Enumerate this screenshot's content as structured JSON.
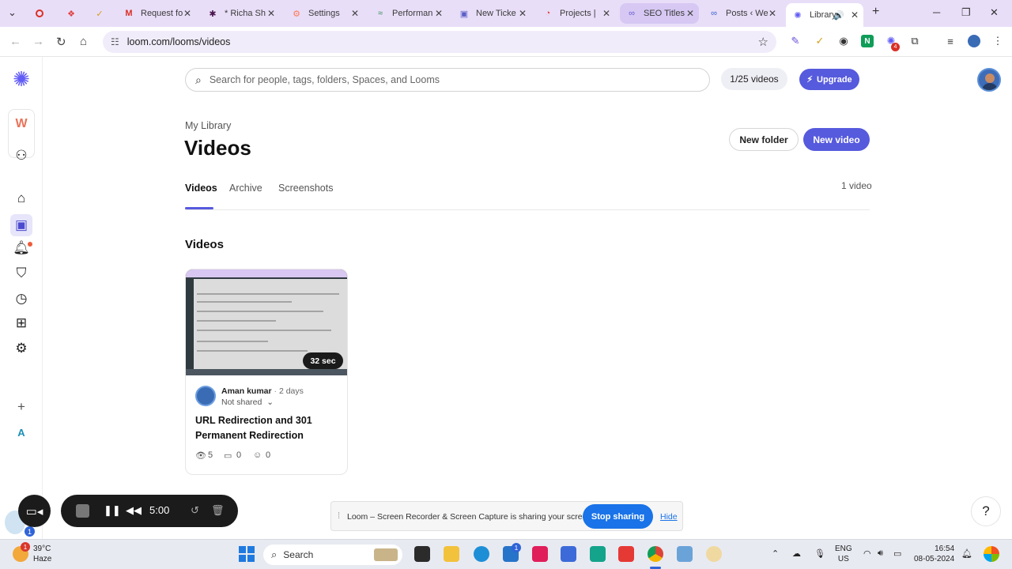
{
  "browser": {
    "tabs": [
      {
        "label": "",
        "icon": "record-icon",
        "color": "#d93025"
      },
      {
        "label": "",
        "icon": "extension-icon",
        "color": "#e04040"
      },
      {
        "label": "",
        "icon": "check-icon",
        "color": "#e0a020"
      },
      {
        "label": "Request fo",
        "icon": "gmail-icon",
        "color": "#d93025"
      },
      {
        "label": "* Richa Sh",
        "icon": "slack-icon",
        "color": "#4a154b"
      },
      {
        "label": "Settings",
        "icon": "hubspot-icon",
        "color": "#ff7a59"
      },
      {
        "label": "Performan",
        "icon": "semrush-icon",
        "color": "#2e8b57"
      },
      {
        "label": "New Ticke",
        "icon": "teams-icon",
        "color": "#5b5fc7"
      },
      {
        "label": "Projects |",
        "icon": "projects-icon",
        "color": "#e04040"
      },
      {
        "label": "SEO Titles",
        "icon": "link-icon",
        "color": "#6a5acd"
      },
      {
        "label": "Posts ‹ We",
        "icon": "link-icon",
        "color": "#3a5fcd"
      },
      {
        "label": "Library",
        "icon": "loom-icon",
        "color": "#625df5"
      }
    ],
    "url": "loom.com/looms/videos"
  },
  "header": {
    "search_placeholder": "Search for people, tags, folders, Spaces, and Looms",
    "quota": "1/25 videos",
    "upgrade_label": "Upgrade"
  },
  "sidebar": {
    "workspace_initial": "W",
    "bottom_initial": "A"
  },
  "page": {
    "breadcrumb": "My Library",
    "title": "Videos",
    "new_folder_label": "New folder",
    "new_video_label": "New video",
    "tabs": [
      "Videos",
      "Archive",
      "Screenshots"
    ],
    "video_count": "1 video",
    "section_title": "Videos"
  },
  "video": {
    "duration": "32 sec",
    "author": "Aman kumar",
    "age": "2 days",
    "sharing": "Not shared",
    "title": "URL Redirection and 301 Permanent Redirection",
    "views": "5",
    "comments": "0",
    "reactions": "0"
  },
  "recorder": {
    "timer": "5:00",
    "badge": "1"
  },
  "share_banner": {
    "message": "Loom – Screen Recorder & Screen Capture is sharing your screen.",
    "stop_label": "Stop sharing",
    "hide_label": "Hide"
  },
  "taskbar": {
    "weather_badge": "1",
    "temperature": "39°C",
    "condition": "Haze",
    "search_label": "Search",
    "store_badge": "1",
    "language": "ENG",
    "region": "US",
    "time": "16:54",
    "date": "08-05-2024"
  },
  "extensions": {
    "badge": "4"
  }
}
